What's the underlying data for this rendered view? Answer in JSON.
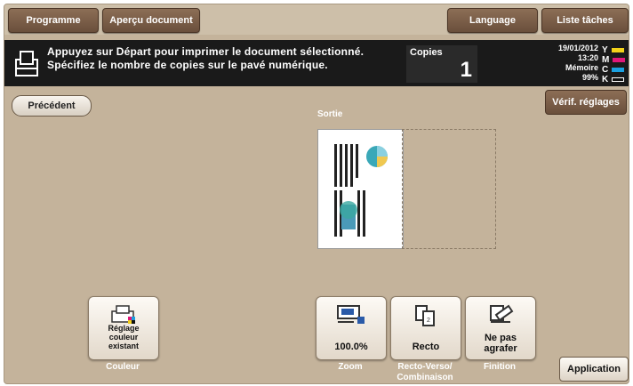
{
  "topbar": {
    "programme": "Programme",
    "apercu": "Aperçu document",
    "language": "Language",
    "liste_taches": "Liste tâches"
  },
  "message": {
    "line1": "Appuyez sur Départ pour imprimer le document sélectionné.",
    "line2": "Spécifiez le nombre de copies sur le pavé numérique."
  },
  "copies": {
    "label": "Copies",
    "value": "1"
  },
  "status": {
    "date": "19/01/2012",
    "time": "13:20",
    "memoire_label": "Mémoire",
    "memoire_value": "99%"
  },
  "toner": [
    {
      "letter": "Y",
      "color": "#f2d21a"
    },
    {
      "letter": "M",
      "color": "#e0187a"
    },
    {
      "letter": "C",
      "color": "#1aa0e0"
    },
    {
      "letter": "K",
      "color": "#111111"
    }
  ],
  "nav": {
    "precedent": "Précédent",
    "verif": "Vérif. réglages"
  },
  "preview": {
    "sortie": "Sortie"
  },
  "functions": {
    "couleur": {
      "button": "Réglage couleur existant",
      "label": "Couleur"
    },
    "zoom": {
      "value": "100.0%",
      "label": "Zoom"
    },
    "recto": {
      "value": "Recto",
      "label": "Recto-Verso/ Combinaison"
    },
    "finition": {
      "value": "Ne pas agrafer",
      "label": "Finition"
    }
  },
  "application": "Application"
}
